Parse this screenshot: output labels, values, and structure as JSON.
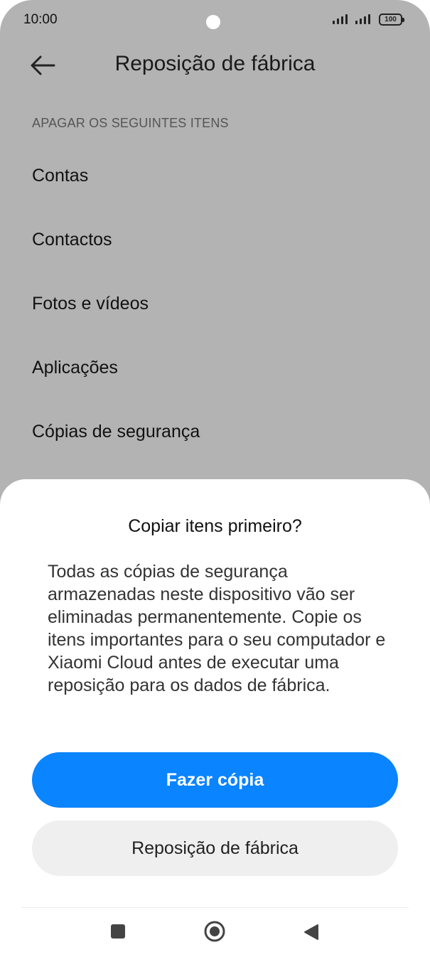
{
  "status_bar": {
    "time": "10:00",
    "battery": "100"
  },
  "header": {
    "title": "Reposição de fábrica",
    "back_icon": "arrow-left-icon"
  },
  "section": {
    "label": "APAGAR OS SEGUINTES ITENS"
  },
  "items": [
    {
      "label": "Contas"
    },
    {
      "label": "Contactos"
    },
    {
      "label": "Fotos e vídeos"
    },
    {
      "label": "Aplicações"
    },
    {
      "label": "Cópias de segurança"
    }
  ],
  "dialog": {
    "title": "Copiar itens primeiro?",
    "message": "Todas as cópias de segurança armazenadas neste dispositivo vão ser eliminadas permanentemente. Copie os itens importantes para o seu computador e Xiaomi Cloud antes de executar uma reposição para os dados de fábrica.",
    "primary_button": "Fazer cópia",
    "secondary_button": "Reposição de fábrica"
  },
  "nav": {
    "icons": [
      "recents-square-icon",
      "home-circle-icon",
      "back-triangle-icon"
    ]
  },
  "colors": {
    "accent": "#0a84ff",
    "scrim": "#b3b3b3",
    "sheet": "#ffffff",
    "secondary_button": "#efefef"
  }
}
